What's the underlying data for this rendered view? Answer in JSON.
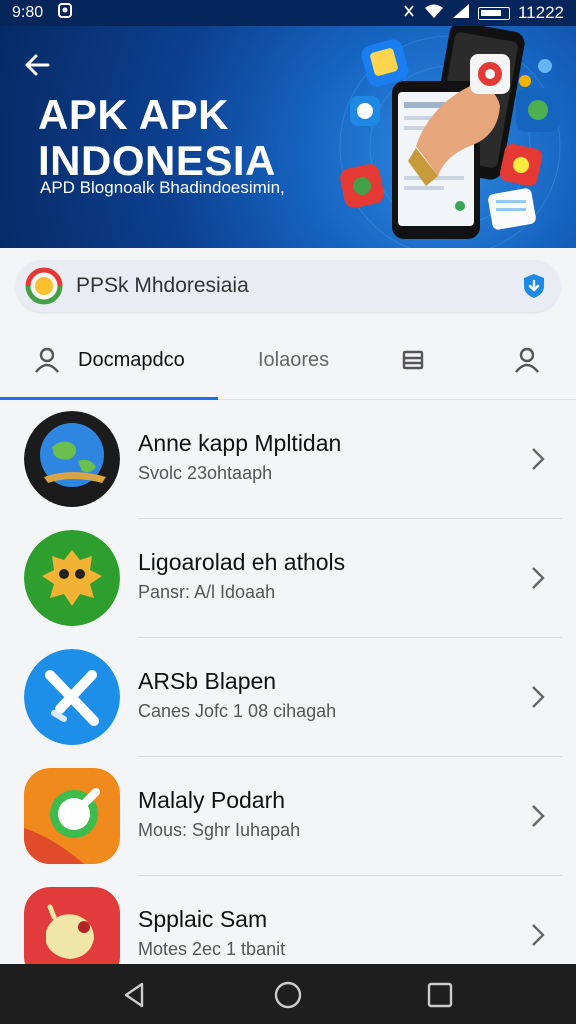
{
  "status_bar": {
    "time": "9:80",
    "right_time": "11222"
  },
  "banner": {
    "title_line1": "APK APK",
    "title_line2": "INDONESIA",
    "subtitle": "APD Blognoalk Bhadindoesimin,"
  },
  "search": {
    "text": "PPSk Mhdoresiaia"
  },
  "tabs": [
    {
      "label": "Docmapdco"
    },
    {
      "label": "Iolaores"
    }
  ],
  "apps": [
    {
      "title": "Anne kapp Mpltidan",
      "subtitle": "Svolc 23ohtaaph",
      "icon": "globe-icon"
    },
    {
      "title": "Ligoarolad eh athols",
      "subtitle": "Pansr: A/l Idoaah",
      "icon": "bird-icon"
    },
    {
      "title": "ARSb Blapen",
      "subtitle": "Canes Jofc 1 08 cihagah",
      "icon": "x-app-icon"
    },
    {
      "title": "Malaly Podarh",
      "subtitle": "Mous: Sghr Iuhapah",
      "icon": "chat-icon"
    },
    {
      "title": "Spplaic Sam",
      "subtitle": "Motes 2ec 1 tbanit",
      "icon": "cartoon-icon"
    }
  ],
  "colors": {
    "banner": "#0c3f8e",
    "accent": "#1a73e8",
    "navbar": "#1e1e1e"
  }
}
